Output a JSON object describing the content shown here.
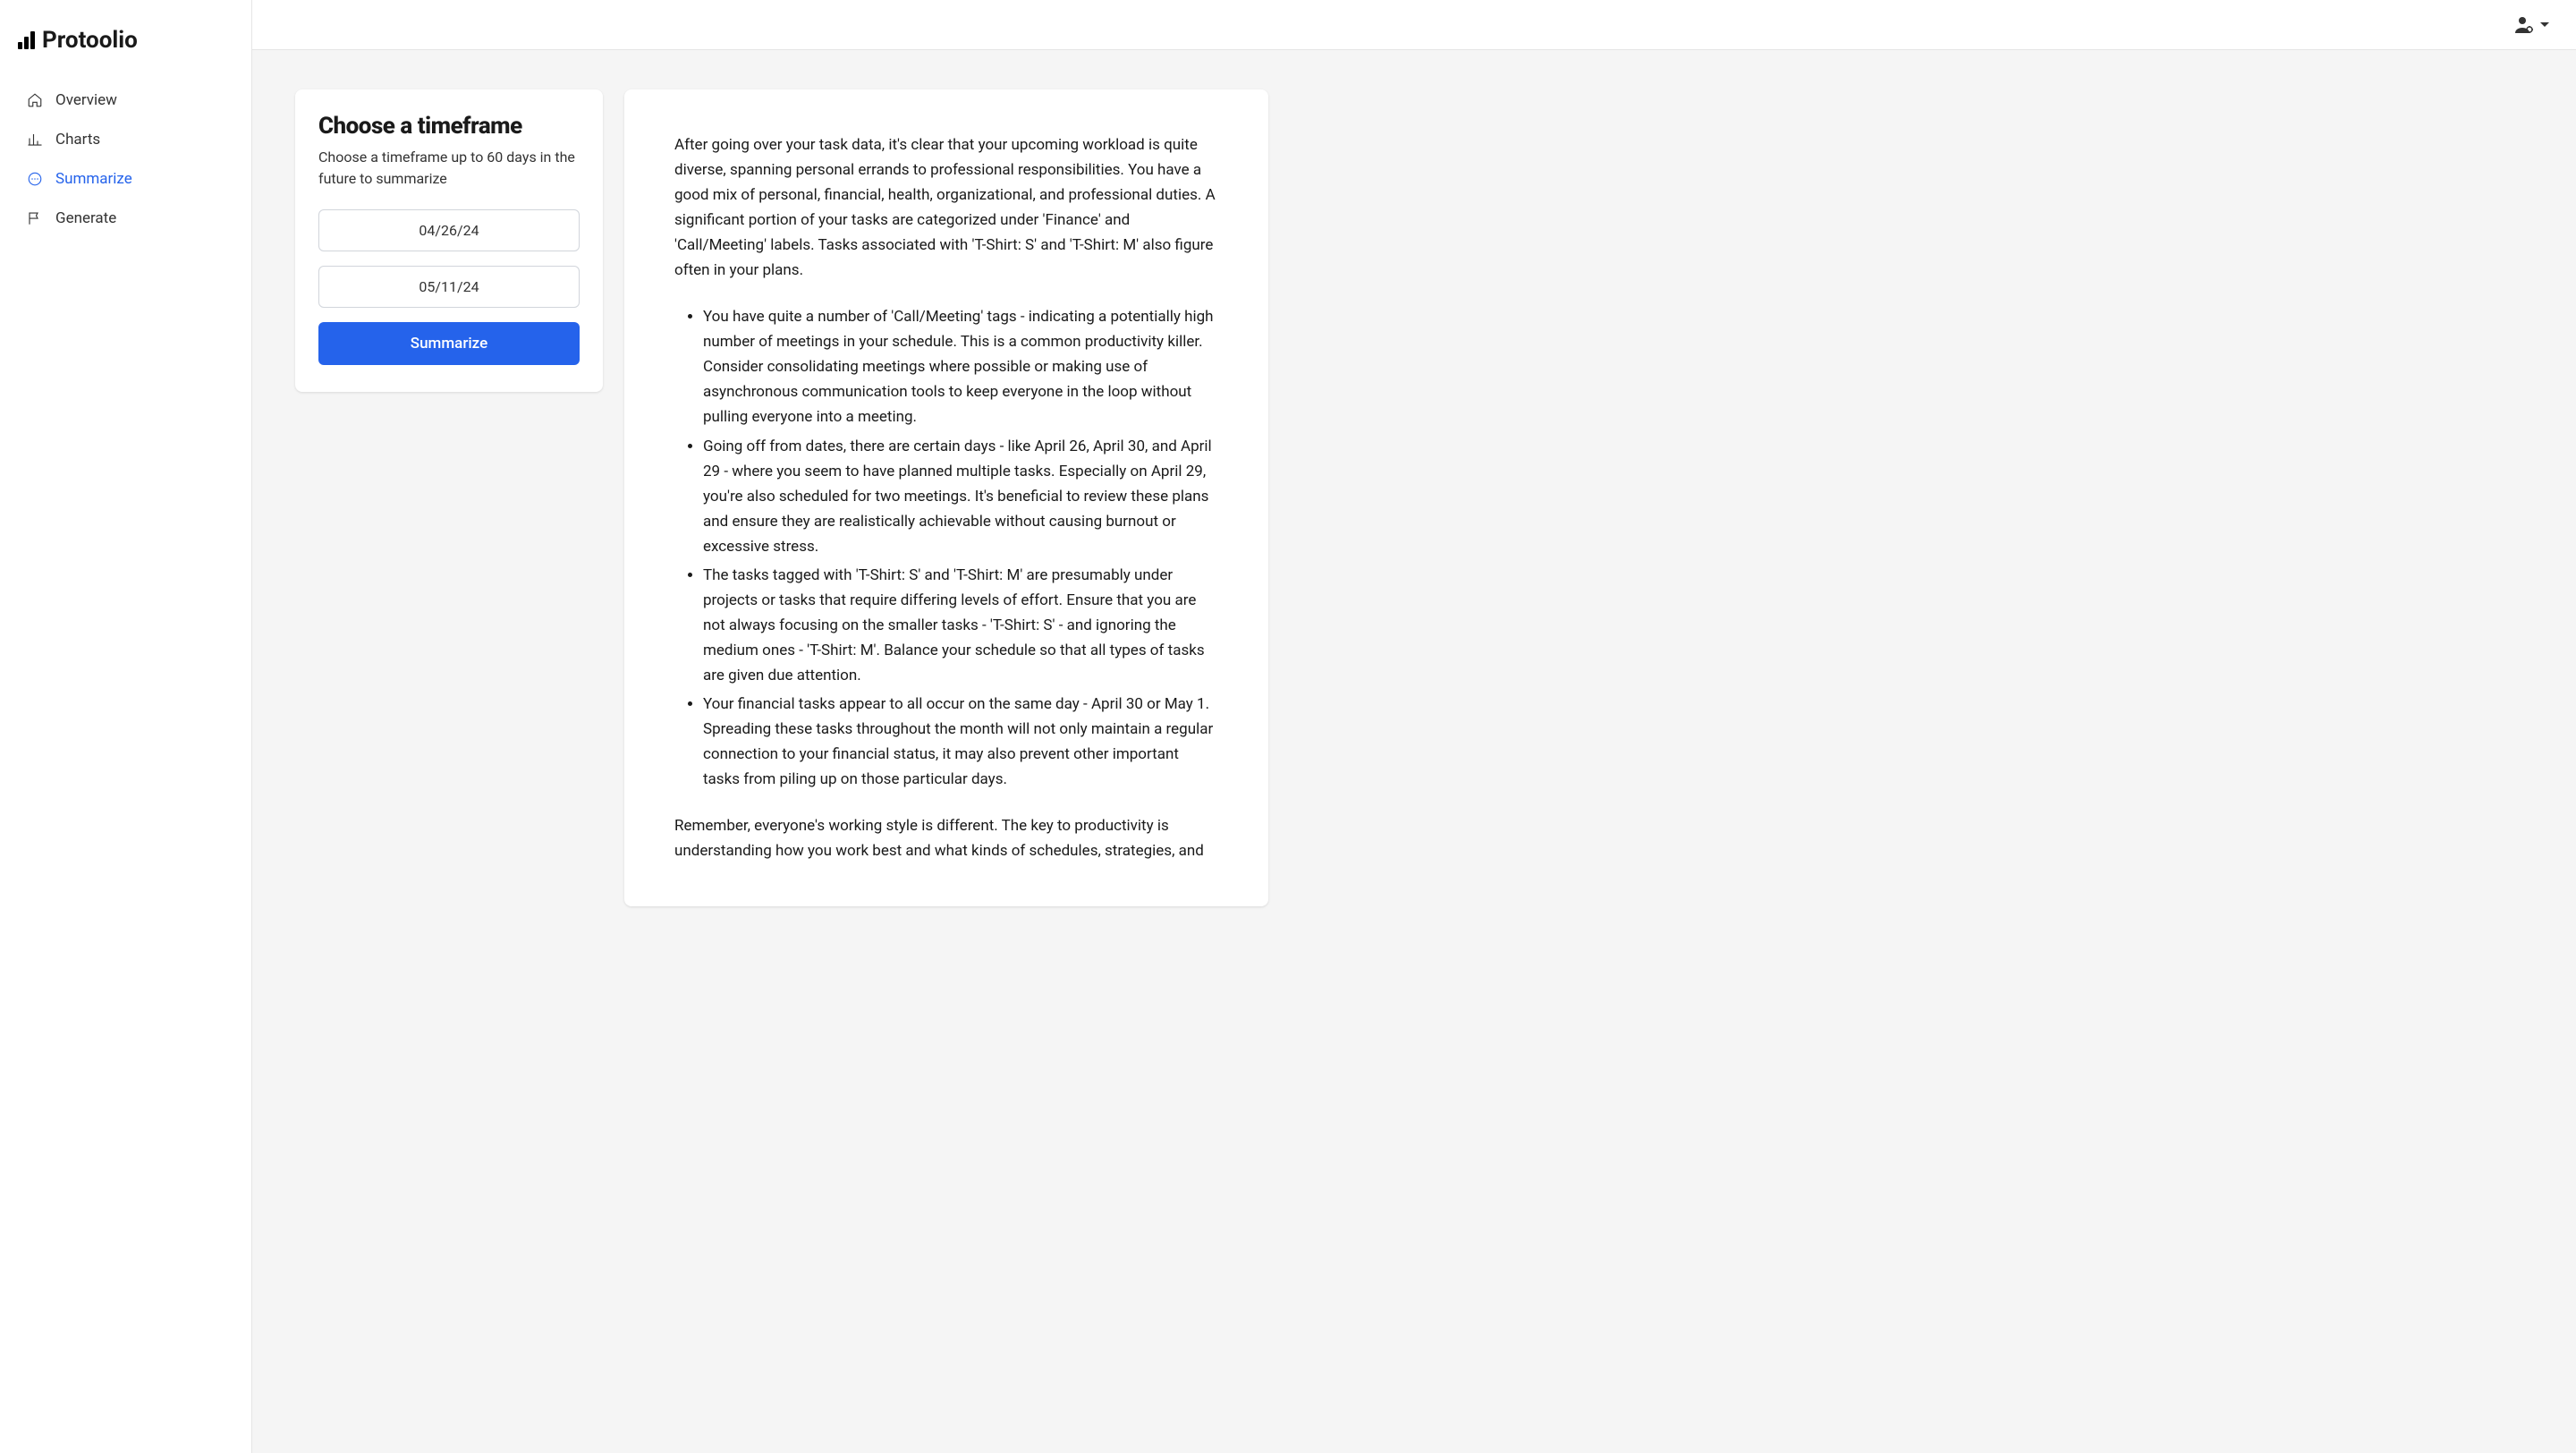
{
  "brand": "Protoolio",
  "sidebar": {
    "items": [
      {
        "label": "Overview",
        "icon": "house-icon"
      },
      {
        "label": "Charts",
        "icon": "bar-chart-icon"
      },
      {
        "label": "Summarize",
        "icon": "chat-icon",
        "active": true
      },
      {
        "label": "Generate",
        "icon": "flag-icon"
      }
    ]
  },
  "timeframe": {
    "heading": "Choose a timeframe",
    "subtitle": "Choose a timeframe up to 60 days in the future to summarize",
    "start_date": "04/26/24",
    "end_date": "05/11/24",
    "button_label": "Summarize"
  },
  "summary": {
    "intro": "After going over your task data, it's clear that your upcoming workload is quite diverse, spanning personal errands to professional responsibilities. You have a good mix of personal, financial, health, organizational, and professional duties. A significant portion of your tasks are categorized under 'Finance' and 'Call/Meeting' labels. Tasks associated with 'T-Shirt: S' and 'T-Shirt: M' also figure often in your plans.",
    "bullets": [
      "You have quite a number of 'Call/Meeting' tags - indicating a potentially high number of meetings in your schedule. This is a common productivity killer. Consider consolidating meetings where possible or making use of asynchronous communication tools to keep everyone in the loop without pulling everyone into a meeting.",
      "Going off from dates, there are certain days - like April 26, April 30, and April 29 - where you seem to have planned multiple tasks. Especially on April 29, you're also scheduled for two meetings. It's beneficial to review these plans and ensure they are realistically achievable without causing burnout or excessive stress.",
      "The tasks tagged with 'T-Shirt: S' and 'T-Shirt: M' are presumably under projects or tasks that require differing levels of effort. Ensure that you are not always focusing on the smaller tasks - 'T-Shirt: S' - and ignoring the medium ones - 'T-Shirt: M'. Balance your schedule so that all types of tasks are given due attention.",
      "Your financial tasks appear to all occur on the same day - April 30 or May 1. Spreading these tasks throughout the month will not only maintain a regular connection to your financial status, it may also prevent other important tasks from piling up on those particular days."
    ],
    "outro": "Remember, everyone's working style is different. The key to productivity is understanding how you work best and what kinds of schedules, strategies, and"
  }
}
